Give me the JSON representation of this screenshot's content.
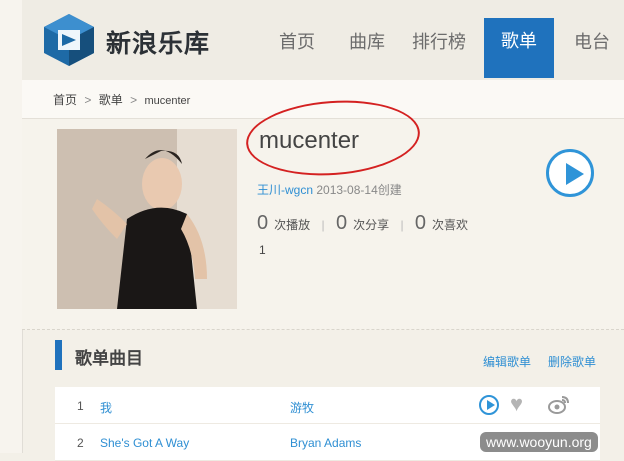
{
  "logo": {
    "text": "新浪乐库"
  },
  "nav": [
    "首页",
    "曲库",
    "排行榜",
    "歌单",
    "电台"
  ],
  "nav_active": "歌单",
  "breadcrumb": [
    "首页",
    "歌单",
    "mucenter"
  ],
  "playlist": {
    "title": "mucenter",
    "creator": "王川-wgcn",
    "created": "2013-08-14创建",
    "plays_num": "0",
    "plays_label": "次播放",
    "shares_num": "0",
    "shares_label": "次分享",
    "likes_num": "0",
    "likes_label": "次喜欢",
    "extra": "1"
  },
  "section": {
    "title": "歌单曲目",
    "edit": "编辑歌单",
    "delete": "删除歌单"
  },
  "tracks": [
    {
      "no": "1",
      "name": "我",
      "artist": "游牧"
    },
    {
      "no": "2",
      "name": "She's Got A Way",
      "artist": "Bryan Adams"
    }
  ],
  "watermark": "www.wooyun.org",
  "colors": {
    "brand_blue": "#1f72bd",
    "link_blue": "#2f8fd3",
    "annotation_red": "#d42121"
  }
}
